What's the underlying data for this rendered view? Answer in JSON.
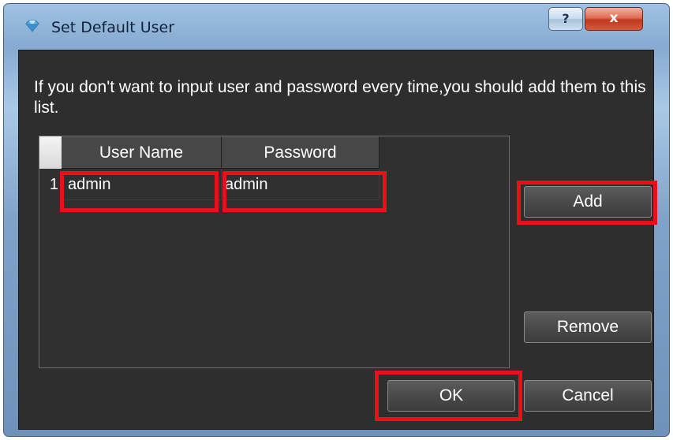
{
  "window": {
    "title": "Set Default User",
    "help_label": "?",
    "close_label": "x",
    "icons": {
      "app": "app-diamond-icon",
      "help": "help-icon",
      "close": "close-icon"
    }
  },
  "dialog": {
    "instruction": "If you don't want to input user and password every time,you should add them to this list."
  },
  "table": {
    "columns": [
      "User Name",
      "Password"
    ],
    "rows": [
      {
        "index": "1",
        "user_name": "admin",
        "password": "admin"
      }
    ]
  },
  "buttons": {
    "add": "Add",
    "remove": "Remove",
    "ok": "OK",
    "cancel": "Cancel"
  },
  "colors": {
    "highlight": "#e8111a",
    "dialog_bg": "#2e2e2e",
    "titlebar": "#8fb3d8"
  }
}
